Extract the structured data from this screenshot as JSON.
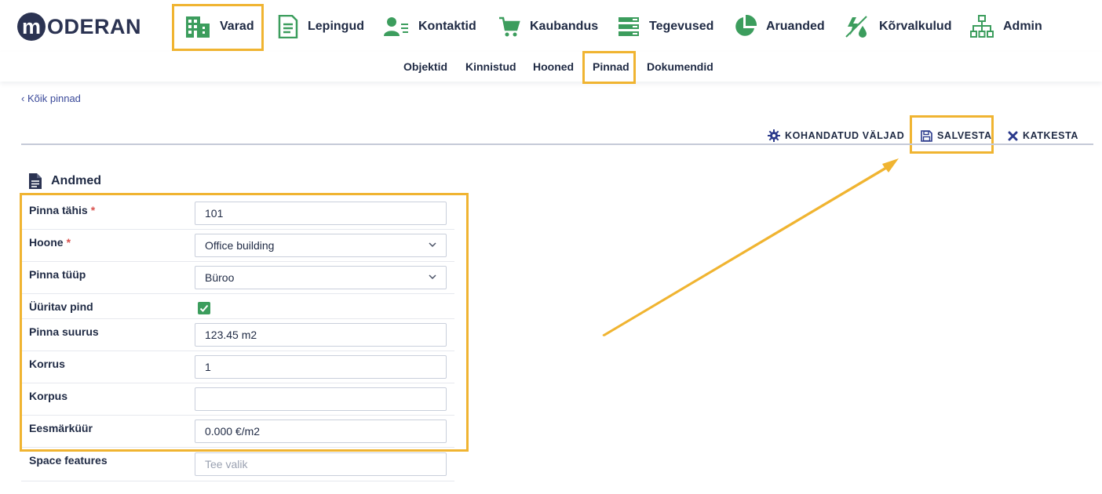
{
  "logo": {
    "text": "ODERAN",
    "mark": "m"
  },
  "nav": [
    {
      "label": "Varad",
      "icon": "building-icon"
    },
    {
      "label": "Lepingud",
      "icon": "document-icon"
    },
    {
      "label": "Kontaktid",
      "icon": "contact-icon"
    },
    {
      "label": "Kaubandus",
      "icon": "cart-icon"
    },
    {
      "label": "Tegevused",
      "icon": "tasks-icon"
    },
    {
      "label": "Aruanded",
      "icon": "pie-chart-icon"
    },
    {
      "label": "Kõrvalkulud",
      "icon": "utilities-icon"
    },
    {
      "label": "Admin",
      "icon": "org-chart-icon"
    }
  ],
  "subnav": [
    "Objektid",
    "Kinnistud",
    "Hooned",
    "Pinnad",
    "Dokumendid"
  ],
  "back_link": "Kõik pinnad",
  "toolbar": {
    "custom_fields": "KOHANDATUD VÄLJAD",
    "save": "SALVESTA",
    "cancel": "KATKESTA"
  },
  "section": {
    "title": "Andmed"
  },
  "form": {
    "rows": [
      {
        "label": "Pinna tähis",
        "value": "101",
        "placeholder": ""
      },
      {
        "label": "Hoone",
        "value": "Office building"
      },
      {
        "label": "Pinna tüüp",
        "value": "Büroo"
      },
      {
        "label": "Üüritav pind",
        "checked": true
      },
      {
        "label": "Pinna suurus",
        "value": "123.45 m2"
      },
      {
        "label": "Korrus",
        "value": "1"
      },
      {
        "label": "Korpus",
        "value": ""
      },
      {
        "label": "Eesmärküür",
        "value": "0.000 €/m2"
      },
      {
        "label": "Space features",
        "placeholder": "Tee valik"
      }
    ]
  },
  "colors": {
    "accent": "#f0b431",
    "green": "#3c9d5d",
    "navy": "#2b3352"
  }
}
